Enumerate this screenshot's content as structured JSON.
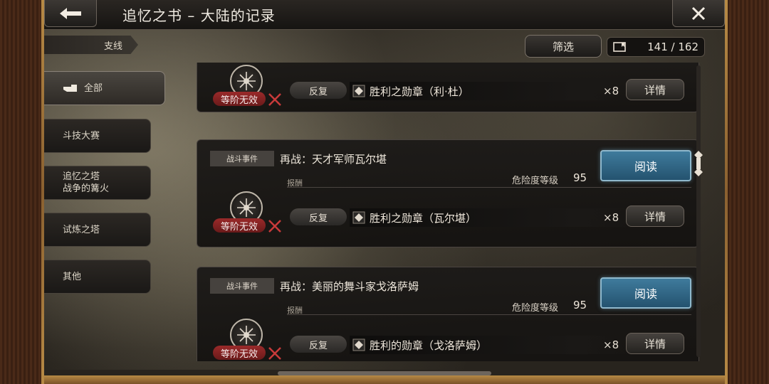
{
  "header": {
    "title": "追忆之书 – 大陆的记录"
  },
  "branch_tag": "支线",
  "filter_label": "筛选",
  "counter": "141 / 162",
  "tabs": [
    {
      "label": "全部",
      "active": true
    },
    {
      "label": "斗技大赛"
    },
    {
      "label": "追忆之塔\n战争的篝火"
    },
    {
      "label": "试炼之塔"
    },
    {
      "label": "其他"
    }
  ],
  "entries": [
    {
      "partial": true,
      "rank_badge": "等阶无效",
      "repeat_label": "反复",
      "reward": "胜利之勋章（利·杜）",
      "count": "×8",
      "detail_label": "详情"
    },
    {
      "type": "战斗事件",
      "title": "再战：天才军师瓦尔堪",
      "read_label": "阅读",
      "reward_label": "报酬",
      "danger_label": "危险度等级",
      "danger_value": "95",
      "rank_badge": "等阶无效",
      "repeat_label": "反复",
      "reward": "胜利之勋章（瓦尔堪）",
      "count": "×8",
      "detail_label": "详情"
    },
    {
      "type": "战斗事件",
      "title": "再战：美丽的舞斗家戈洛萨姆",
      "read_label": "阅读",
      "reward_label": "报酬",
      "danger_label": "危险度等级",
      "danger_value": "95",
      "rank_badge": "等阶无效",
      "repeat_label": "反复",
      "reward": "胜利的勋章（戈洛萨姆）",
      "count": "×8",
      "detail_label": "详情"
    }
  ],
  "colors": {
    "read_button": "#2f6a8a",
    "rank_badge": "#8a2222",
    "frame": "#b78a45"
  }
}
